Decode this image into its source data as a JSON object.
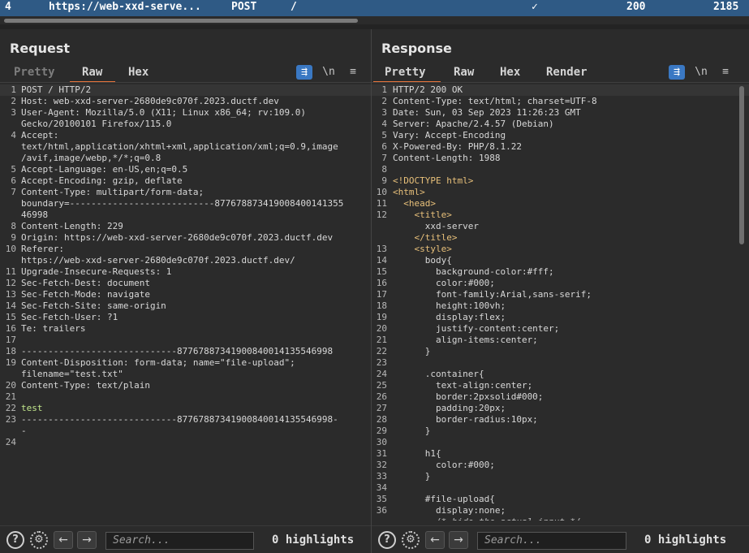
{
  "history_row": {
    "index": "4",
    "host": "https://web-xxd-serve...",
    "method": "POST",
    "url": "/",
    "check": "✓",
    "status": "200",
    "length": "2185"
  },
  "request": {
    "title": "Request",
    "tabs": [
      "Pretty",
      "Raw",
      "Hex"
    ],
    "active_tab": "Raw",
    "newline_label": "\\n",
    "lines": [
      {
        "n": "1",
        "t": "POST / HTTP/2"
      },
      {
        "n": "2",
        "t": "Host: web-xxd-server-2680de9c070f.2023.ductf.dev"
      },
      {
        "n": "3",
        "t": "User-Agent: Mozilla/5.0 (X11; Linux x86_64; rv:109.0)"
      },
      {
        "n": "",
        "t": "Gecko/20100101 Firefox/115.0"
      },
      {
        "n": "4",
        "t": "Accept:"
      },
      {
        "n": "",
        "t": "text/html,application/xhtml+xml,application/xml;q=0.9,image"
      },
      {
        "n": "",
        "t": "/avif,image/webp,*/*;q=0.8"
      },
      {
        "n": "5",
        "t": "Accept-Language: en-US,en;q=0.5"
      },
      {
        "n": "6",
        "t": "Accept-Encoding: gzip, deflate"
      },
      {
        "n": "7",
        "t": "Content-Type: multipart/form-data;"
      },
      {
        "n": "",
        "t": "boundary=---------------------------877678873419008400141355"
      },
      {
        "n": "",
        "t": "46998"
      },
      {
        "n": "8",
        "t": "Content-Length: 229"
      },
      {
        "n": "9",
        "t": "Origin: https://web-xxd-server-2680de9c070f.2023.ductf.dev"
      },
      {
        "n": "10",
        "t": "Referer:"
      },
      {
        "n": "",
        "t": "https://web-xxd-server-2680de9c070f.2023.ductf.dev/"
      },
      {
        "n": "11",
        "t": "Upgrade-Insecure-Requests: 1"
      },
      {
        "n": "12",
        "t": "Sec-Fetch-Dest: document"
      },
      {
        "n": "13",
        "t": "Sec-Fetch-Mode: navigate"
      },
      {
        "n": "14",
        "t": "Sec-Fetch-Site: same-origin"
      },
      {
        "n": "15",
        "t": "Sec-Fetch-User: ?1"
      },
      {
        "n": "16",
        "t": "Te: trailers"
      },
      {
        "n": "17",
        "t": ""
      },
      {
        "n": "18",
        "t": "-----------------------------87767887341900840014135546998"
      },
      {
        "n": "19",
        "t": "Content-Disposition: form-data; name=\"file-upload\";"
      },
      {
        "n": "",
        "t": "filename=\"test.txt\""
      },
      {
        "n": "20",
        "t": "Content-Type: text/plain"
      },
      {
        "n": "21",
        "t": ""
      },
      {
        "n": "22",
        "t": "test"
      },
      {
        "n": "23",
        "t": "-----------------------------87767887341900840014135546998-"
      },
      {
        "n": "",
        "t": "-"
      },
      {
        "n": "24",
        "t": ""
      }
    ],
    "search_placeholder": "Search...",
    "highlights": "0 highlights"
  },
  "response": {
    "title": "Response",
    "tabs": [
      "Pretty",
      "Raw",
      "Hex",
      "Render"
    ],
    "active_tab": "Pretty",
    "newline_label": "\\n",
    "lines": [
      {
        "n": "1",
        "t": "HTTP/2 200 OK"
      },
      {
        "n": "2",
        "t": "Content-Type: text/html; charset=UTF-8"
      },
      {
        "n": "3",
        "t": "Date: Sun, 03 Sep 2023 11:26:23 GMT"
      },
      {
        "n": "4",
        "t": "Server: Apache/2.4.57 (Debian)"
      },
      {
        "n": "5",
        "t": "Vary: Accept-Encoding"
      },
      {
        "n": "6",
        "t": "X-Powered-By: PHP/8.1.22"
      },
      {
        "n": "7",
        "t": "Content-Length: 1988"
      },
      {
        "n": "8",
        "t": ""
      },
      {
        "n": "9",
        "t": "<!DOCTYPE html>"
      },
      {
        "n": "10",
        "t": "<html>"
      },
      {
        "n": "11",
        "t": "  <head>"
      },
      {
        "n": "12",
        "t": "    <title>"
      },
      {
        "n": "",
        "t": "      xxd-server"
      },
      {
        "n": "",
        "t": "    </title>"
      },
      {
        "n": "13",
        "t": "    <style>"
      },
      {
        "n": "14",
        "t": "      body{"
      },
      {
        "n": "15",
        "t": "        background-color:#fff;"
      },
      {
        "n": "16",
        "t": "        color:#000;"
      },
      {
        "n": "17",
        "t": "        font-family:Arial,sans-serif;"
      },
      {
        "n": "18",
        "t": "        height:100vh;"
      },
      {
        "n": "19",
        "t": "        display:flex;"
      },
      {
        "n": "20",
        "t": "        justify-content:center;"
      },
      {
        "n": "21",
        "t": "        align-items:center;"
      },
      {
        "n": "22",
        "t": "      }"
      },
      {
        "n": "23",
        "t": ""
      },
      {
        "n": "24",
        "t": "      .container{"
      },
      {
        "n": "25",
        "t": "        text-align:center;"
      },
      {
        "n": "26",
        "t": "        border:2pxsolid#000;"
      },
      {
        "n": "27",
        "t": "        padding:20px;"
      },
      {
        "n": "28",
        "t": "        border-radius:10px;"
      },
      {
        "n": "29",
        "t": "      }"
      },
      {
        "n": "30",
        "t": ""
      },
      {
        "n": "31",
        "t": "      h1{"
      },
      {
        "n": "32",
        "t": "        color:#000;"
      },
      {
        "n": "33",
        "t": "      }"
      },
      {
        "n": "34",
        "t": ""
      },
      {
        "n": "35",
        "t": "      #file-upload{"
      },
      {
        "n": "36",
        "t": "        display:none;"
      },
      {
        "n": "",
        "t": "        /* hide the actual input */"
      }
    ],
    "search_placeholder": "Search...",
    "highlights": "0 highlights"
  },
  "icons": {
    "help": "help-icon",
    "settings": "gear-icon",
    "back": "arrow-left-icon",
    "forward": "arrow-right-icon",
    "wrap": "word-wrap-icon",
    "menu": "menu-icon"
  },
  "colors": {
    "accent": "#e8743b",
    "selection": "#2f5a85",
    "toggle_active": "#3a78c3"
  }
}
